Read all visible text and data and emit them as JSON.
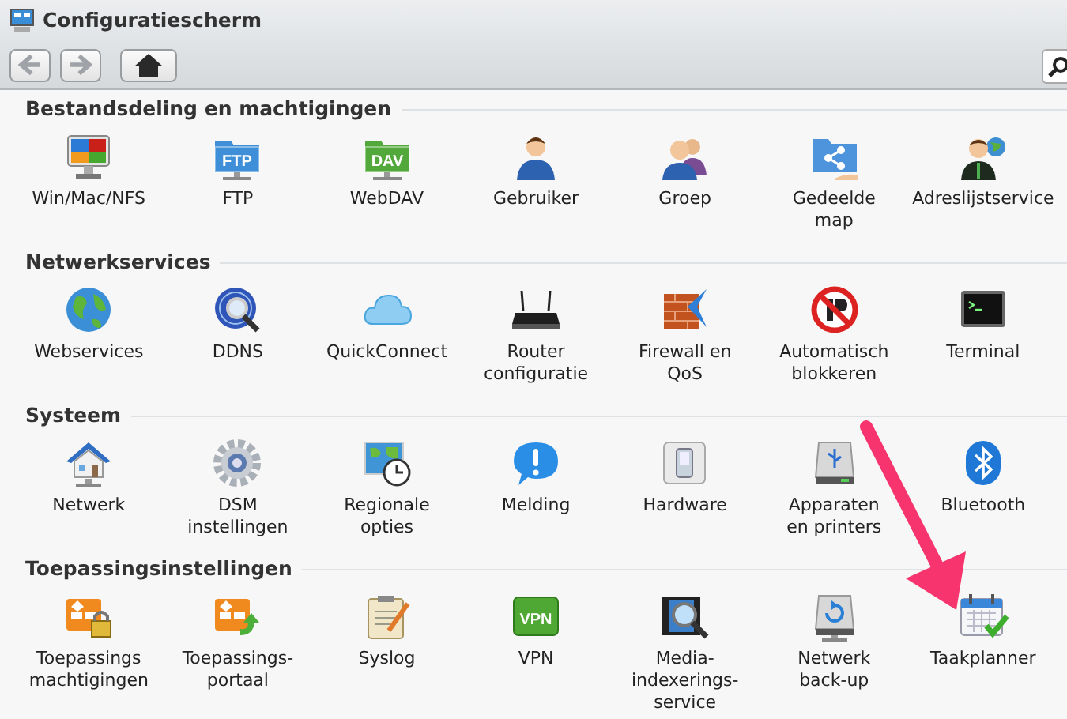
{
  "window": {
    "title": "Configuratiescherm"
  },
  "toolbar": {
    "buttons": [
      {
        "kind": "back",
        "disabled": true
      },
      {
        "kind": "forward",
        "disabled": true
      },
      {
        "kind": "home",
        "disabled": false
      }
    ]
  },
  "sections": [
    {
      "title": "Bestandsdeling en machtigingen",
      "items": [
        {
          "label": "Win/Mac/NFS",
          "kind": "monitor"
        },
        {
          "label": "FTP",
          "kind": "folder",
          "badge": "FTP",
          "color": "#3f8fd8"
        },
        {
          "label": "WebDAV",
          "kind": "folder",
          "badge": "DAV",
          "color": "#52a83a"
        },
        {
          "label": "Gebruiker",
          "kind": "user"
        },
        {
          "label": "Groep",
          "kind": "users"
        },
        {
          "label": "Gedeelde map",
          "kind": "shared"
        },
        {
          "label": "Adreslijstservice",
          "kind": "usernet"
        }
      ]
    },
    {
      "title": "Netwerkservices",
      "items": [
        {
          "label": "Webservices",
          "kind": "globe"
        },
        {
          "label": "DDNS",
          "kind": "ddns"
        },
        {
          "label": "QuickConnect",
          "kind": "cloud"
        },
        {
          "label": "Router configuratie",
          "kind": "router"
        },
        {
          "label": "Firewall en QoS",
          "kind": "firewall"
        },
        {
          "label": "Automatisch blokkeren",
          "kind": "block"
        },
        {
          "label": "Terminal",
          "kind": "terminal"
        }
      ]
    },
    {
      "title": "Systeem",
      "items": [
        {
          "label": "Netwerk",
          "kind": "house"
        },
        {
          "label": "DSM instellingen",
          "kind": "gear"
        },
        {
          "label": "Regionale opties",
          "kind": "mapclock"
        },
        {
          "label": "Melding",
          "kind": "alert"
        },
        {
          "label": "Hardware",
          "kind": "switch"
        },
        {
          "label": "Apparaten en printers",
          "kind": "usb"
        },
        {
          "label": "Bluetooth",
          "kind": "bluetooth"
        }
      ]
    },
    {
      "title": "Toepassingsinstellingen",
      "items": [
        {
          "label": "Toepassings machtigingen",
          "kind": "applock"
        },
        {
          "label": "Toepassings-portaal",
          "kind": "appportal"
        },
        {
          "label": "Syslog",
          "kind": "notepad"
        },
        {
          "label": "VPN",
          "kind": "vpn",
          "badge": "VPN",
          "color": "#4fa834"
        },
        {
          "label": "Media-indexerings-service",
          "kind": "film"
        },
        {
          "label": "Netwerk back-up",
          "kind": "backup"
        },
        {
          "label": "Taakplanner",
          "kind": "calendar"
        }
      ]
    }
  ]
}
